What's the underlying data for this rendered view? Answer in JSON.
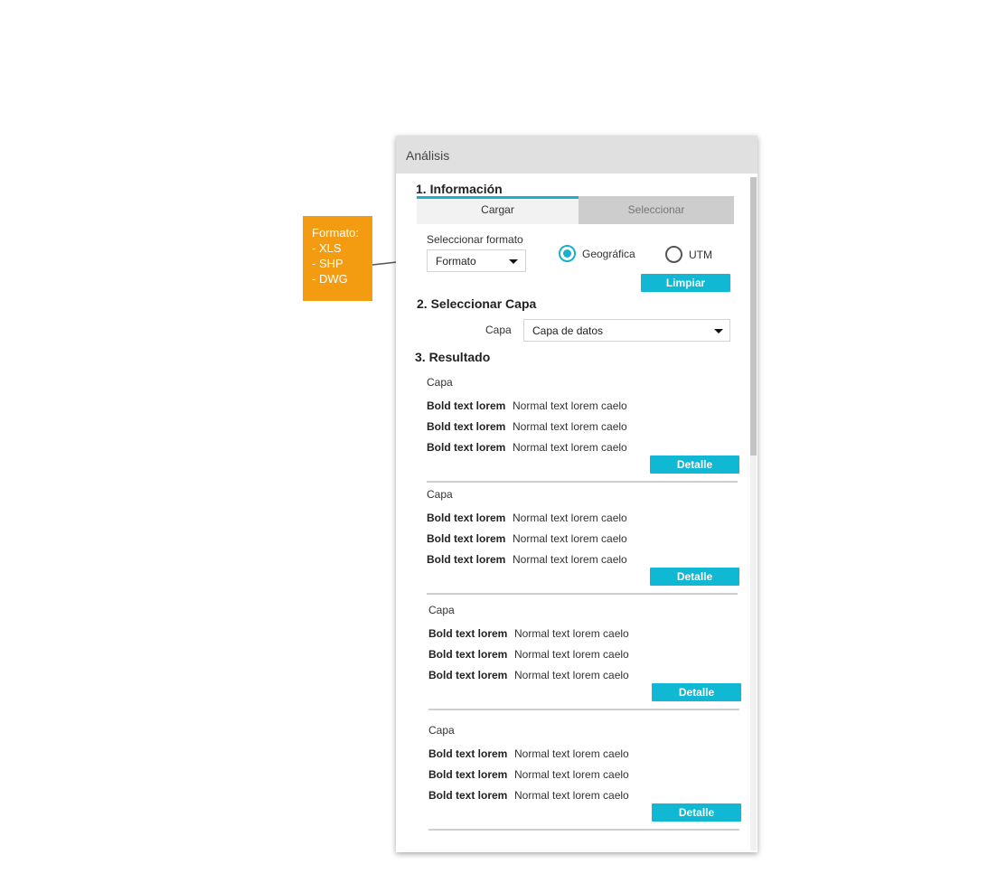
{
  "note": {
    "lines": [
      "Formato:",
      "- XLS",
      "- SHP",
      "- DWG"
    ]
  },
  "panel": {
    "title": "Análisis",
    "section1": {
      "title": "1. Información",
      "tabs": [
        {
          "label": "Cargar",
          "active": true
        },
        {
          "label": "Seleccionar",
          "active": false
        }
      ],
      "format_label": "Seleccionar formato",
      "format_value": "Formato",
      "radios": [
        {
          "label": "Geográfica",
          "selected": true
        },
        {
          "label": "UTM",
          "selected": false
        }
      ],
      "clear_button": "Limpiar"
    },
    "section2": {
      "title": "2. Seleccionar Capa",
      "layer_label": "Capa",
      "layer_value": "Capa de datos"
    },
    "section3": {
      "title": "3. Resultado",
      "cards": [
        {
          "title": "Capa",
          "rows": [
            {
              "bold": "Bold text lorem",
              "normal": "Normal text lorem caelo"
            },
            {
              "bold": "Bold text lorem",
              "normal": "Normal text lorem caelo"
            },
            {
              "bold": "Bold text lorem",
              "normal": "Normal text lorem caelo"
            }
          ],
          "button": "Detalle"
        },
        {
          "title": "Capa",
          "rows": [
            {
              "bold": "Bold text lorem",
              "normal": "Normal text lorem caelo"
            },
            {
              "bold": "Bold text lorem",
              "normal": "Normal text lorem caelo"
            },
            {
              "bold": "Bold text lorem",
              "normal": "Normal text lorem caelo"
            }
          ],
          "button": "Detalle"
        },
        {
          "title": "Capa",
          "rows": [
            {
              "bold": "Bold text lorem",
              "normal": "Normal text lorem caelo"
            },
            {
              "bold": "Bold text lorem",
              "normal": "Normal text lorem caelo"
            },
            {
              "bold": "Bold text lorem",
              "normal": "Normal text lorem caelo"
            }
          ],
          "button": "Detalle"
        },
        {
          "title": "Capa",
          "rows": [
            {
              "bold": "Bold text lorem",
              "normal": "Normal text lorem caelo"
            },
            {
              "bold": "Bold text lorem",
              "normal": "Normal text lorem caelo"
            },
            {
              "bold": "Bold text lorem",
              "normal": "Normal text lorem caelo"
            }
          ],
          "button": "Detalle"
        }
      ]
    }
  },
  "colors": {
    "accent": "#11b8d4",
    "note_bg": "#f39c12",
    "header_bg": "#e0e0e0"
  },
  "icons": [
    "caret-down-icon",
    "arrow-icon"
  ]
}
